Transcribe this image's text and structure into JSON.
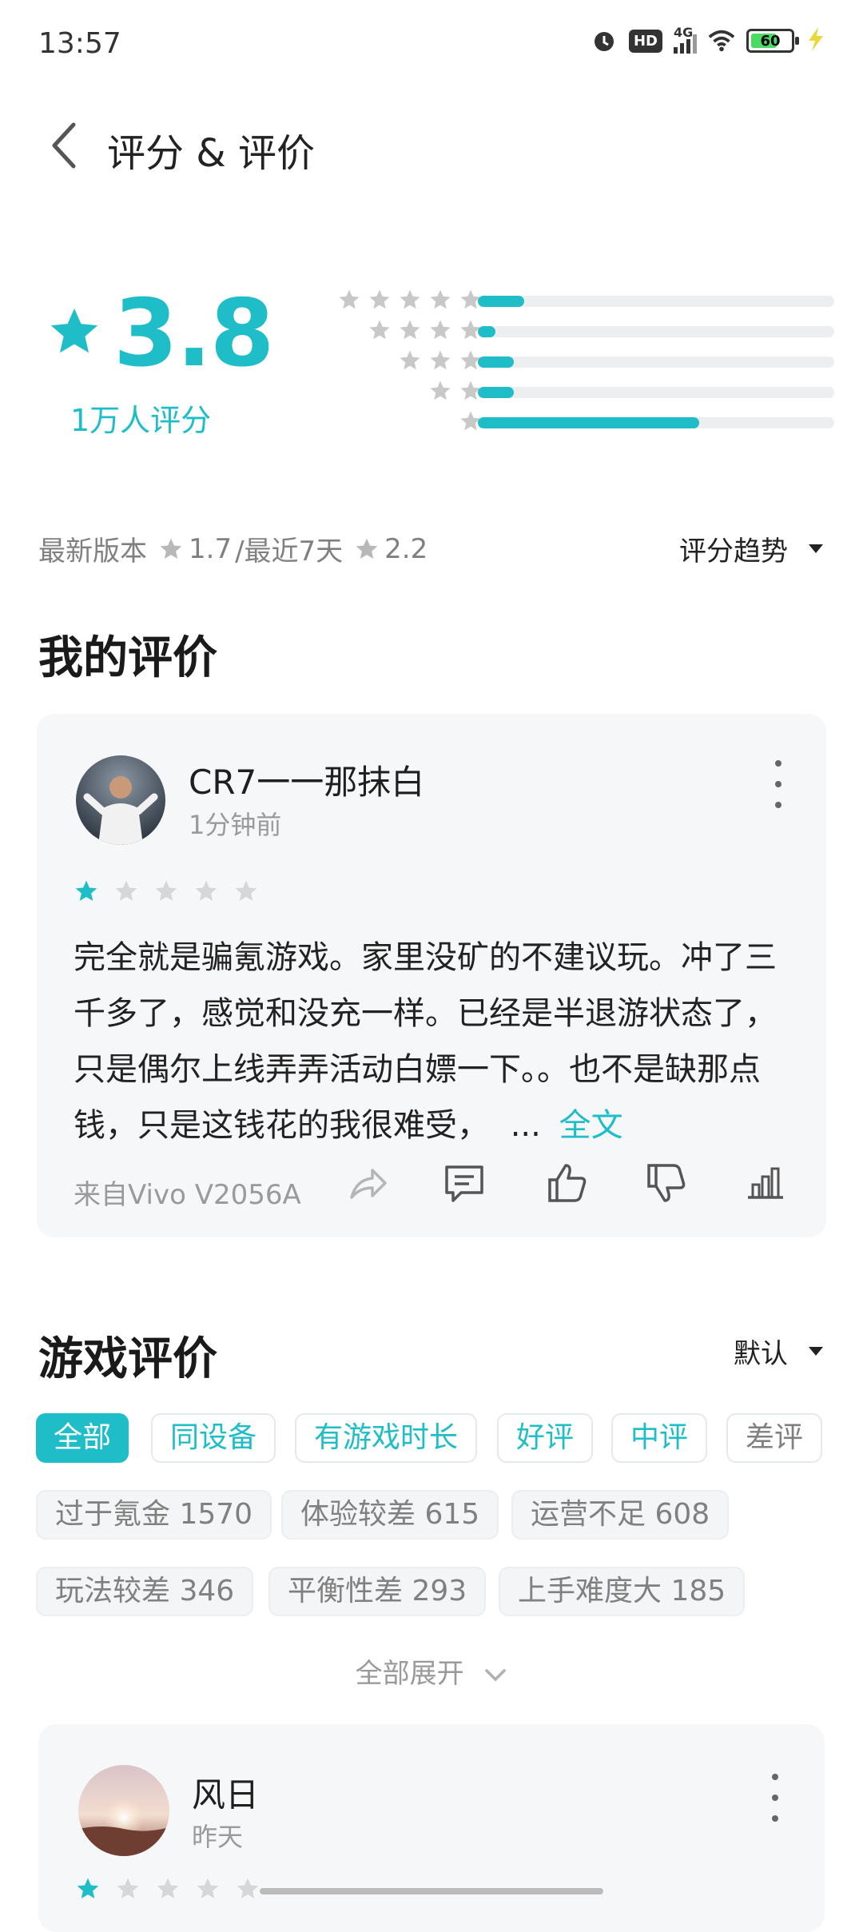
{
  "status_bar": {
    "time": "13:57",
    "hd": "HD",
    "network": "4G",
    "battery": "60"
  },
  "header": {
    "title": "评分 & 评价"
  },
  "rating": {
    "score": "3.8",
    "count_label": "1万人评分",
    "distribution": [
      {
        "stars": 5,
        "fraction": 0.13
      },
      {
        "stars": 4,
        "fraction": 0.05
      },
      {
        "stars": 3,
        "fraction": 0.1
      },
      {
        "stars": 2,
        "fraction": 0.1
      },
      {
        "stars": 1,
        "fraction": 0.62
      }
    ],
    "latest_label": "最新版本",
    "latest_value": "1.7",
    "recent_label": "/最近7天",
    "recent_value": "2.2",
    "trend_label": "评分趋势"
  },
  "my_review": {
    "section_title": "我的评价",
    "username": "CR7一一那抹白",
    "time": "1分钟前",
    "rating": 1,
    "text": "完全就是骗氪游戏。家里没矿的不建议玩。冲了三千多了，感觉和没充一样。已经是半退游状态了，只是偶尔上线弄弄活动白嫖一下。。也不是缺那点钱，只是这钱花的我很难受，",
    "ellipsis": "...",
    "full_label": "全文",
    "device": "来自Vivo V2056A"
  },
  "game_reviews": {
    "section_title": "游戏评价",
    "sort_label": "默认",
    "filters": [
      "全部",
      "同设备",
      "有游戏时长",
      "好评",
      "中评",
      "差评"
    ],
    "keywords": [
      "过于氪金 1570",
      "体验较差 615",
      "运营不足 608",
      "玩法较差 346",
      "平衡性差 293",
      "上手难度大 185"
    ],
    "expand_label": "全部展开",
    "first_review": {
      "username": "风日",
      "time": "昨天",
      "rating": 1
    }
  },
  "colors": {
    "accent": "#1ebdc7",
    "star_empty": "#c8c8c8",
    "card_bg": "#f6f7f8"
  }
}
